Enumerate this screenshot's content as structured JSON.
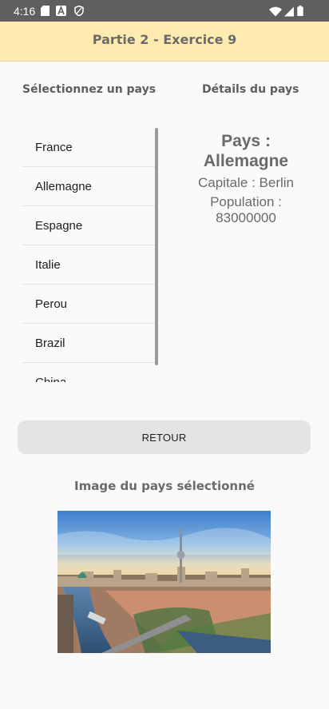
{
  "status_bar": {
    "time": "4:16",
    "left_icons": [
      "sd-card-icon",
      "notification-a-icon",
      "shield-icon"
    ],
    "right_icons": [
      "wifi-icon",
      "signal-icon",
      "battery-icon"
    ]
  },
  "app_bar": {
    "title": "Partie 2 - Exercice 9"
  },
  "left_panel": {
    "heading": "Sélectionnez un pays",
    "countries": [
      "France",
      "Allemagne",
      "Espagne",
      "Italie",
      "Perou",
      "Brazil",
      "China"
    ]
  },
  "right_panel": {
    "heading": "Détails du pays",
    "country_line": "Pays : Allemagne",
    "capital_line": "Capitale : Berlin",
    "population_line": "Population : 83000000"
  },
  "back_button": {
    "label": "RETOUR"
  },
  "image_section": {
    "caption": "Image du pays sélectionné"
  },
  "colors": {
    "app_bar": "#ffebb0",
    "status_bar": "#5f5f5f",
    "button": "#e3e4e4"
  }
}
